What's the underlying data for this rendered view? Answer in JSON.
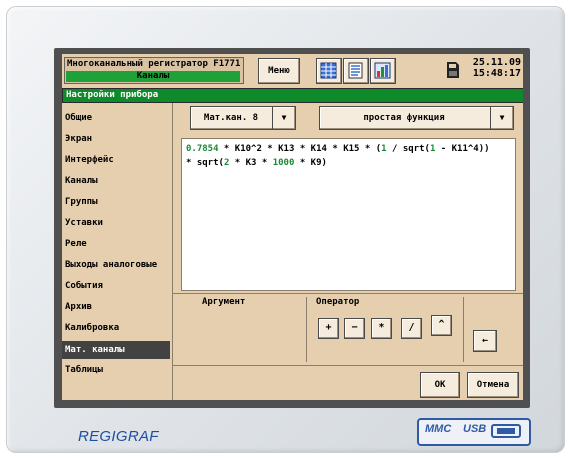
{
  "device": {
    "brand": "REGIGRAF",
    "port_label_1": "MMC",
    "port_label_2": "USB"
  },
  "header": {
    "title": "Многоканальный регистратор F1771",
    "subtitle": "Каналы",
    "menu_label": "Меню",
    "date": "25.11.09",
    "time": "15:48:17",
    "icons": [
      "table-icon",
      "list-icon",
      "chart-icon",
      "memory-card-icon"
    ]
  },
  "section": {
    "title": "Настройки прибора"
  },
  "sidebar": {
    "items": [
      {
        "label": "Общие"
      },
      {
        "label": "Экран"
      },
      {
        "label": "Интерфейс"
      },
      {
        "label": "Каналы"
      },
      {
        "label": "Группы"
      },
      {
        "label": "Уставки"
      },
      {
        "label": "Реле"
      },
      {
        "label": "Выходы аналоговые"
      },
      {
        "label": "События"
      },
      {
        "label": "Архив"
      },
      {
        "label": "Калибровка"
      },
      {
        "label": "Мат. каналы",
        "active": true
      },
      {
        "label": "Таблицы"
      }
    ]
  },
  "channel_select": {
    "value": "Мат.кан. 8",
    "arrow": "▼"
  },
  "function_select": {
    "value": "простая функция",
    "arrow": "▼"
  },
  "formula": {
    "line1": [
      {
        "t": "0.7854",
        "c": "num"
      },
      {
        "t": " * ",
        "c": "txt"
      },
      {
        "t": "K10^2",
        "c": "txt"
      },
      {
        "t": " * ",
        "c": "txt"
      },
      {
        "t": "K13",
        "c": "txt"
      },
      {
        "t": " * ",
        "c": "txt"
      },
      {
        "t": "K14",
        "c": "txt"
      },
      {
        "t": " * ",
        "c": "txt"
      },
      {
        "t": "K15",
        "c": "txt"
      },
      {
        "t": " * (",
        "c": "txt"
      },
      {
        "t": "1",
        "c": "num"
      },
      {
        "t": " / sqrt(",
        "c": "txt"
      },
      {
        "t": "1",
        "c": "num"
      },
      {
        "t": " - K11^4))",
        "c": "txt"
      }
    ],
    "line2": [
      {
        "t": "* sqrt(",
        "c": "txt"
      },
      {
        "t": "2",
        "c": "num"
      },
      {
        "t": " * K3 * ",
        "c": "txt"
      },
      {
        "t": "1000",
        "c": "num"
      },
      {
        "t": " * K9)",
        "c": "txt"
      }
    ]
  },
  "lower": {
    "argument_label": "Аргумент",
    "operator_label": "Оператор",
    "operators": [
      "+",
      "−",
      "*",
      "/",
      "^"
    ],
    "arrow_button": "←"
  },
  "footer": {
    "ok": "OK",
    "cancel": "Отмена"
  }
}
